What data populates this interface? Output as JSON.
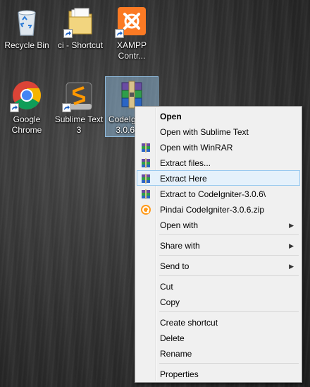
{
  "desktop": {
    "icons": [
      {
        "label": "Recycle Bin",
        "icon": "recycle-bin-icon"
      },
      {
        "label": "ci - Shortcut",
        "icon": "folder-icon"
      },
      {
        "label": "XAMPP Contr...",
        "icon": "xampp-icon"
      },
      {
        "label": "Google Chrome",
        "icon": "chrome-icon"
      },
      {
        "label": "Sublime Text 3",
        "icon": "sublime-icon"
      },
      {
        "label": "CodeIgniter-3.0.6.zip",
        "icon": "winrar-archive-icon"
      }
    ]
  },
  "context_menu": {
    "items": [
      {
        "label": "Open",
        "bold": true
      },
      {
        "label": "Open with Sublime Text"
      },
      {
        "label": "Open with WinRAR",
        "icon": "winrar-icon"
      },
      {
        "label": "Extract files...",
        "icon": "winrar-icon"
      },
      {
        "label": "Extract Here",
        "icon": "winrar-icon",
        "highlighted": true
      },
      {
        "label": "Extract to CodeIgniter-3.0.6\\",
        "icon": "winrar-icon"
      },
      {
        "label": "Pindai CodeIgniter-3.0.6.zip",
        "icon": "antivirus-icon"
      },
      {
        "label": "Open with",
        "submenu": true
      },
      {
        "label": "Share with",
        "submenu": true
      },
      {
        "label": "Send to",
        "submenu": true
      },
      {
        "label": "Cut"
      },
      {
        "label": "Copy"
      },
      {
        "label": "Create shortcut"
      },
      {
        "label": "Delete"
      },
      {
        "label": "Rename"
      },
      {
        "label": "Properties"
      }
    ]
  },
  "colors": {
    "highlight": "#e5f1fb",
    "highlight_border": "#99c9ef",
    "menu_bg": "#f0f0f0"
  }
}
